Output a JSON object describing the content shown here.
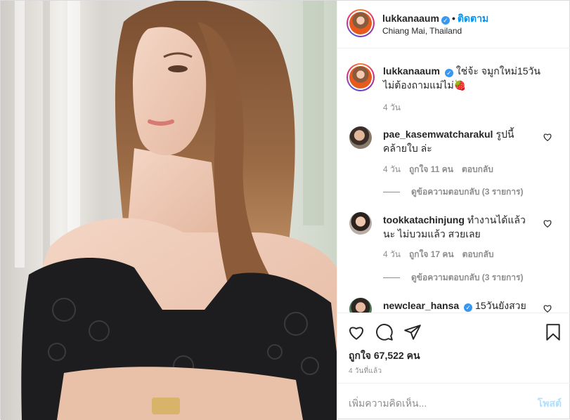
{
  "header": {
    "username": "lukkanaaum",
    "separator": "•",
    "follow_label": "ติดตาม",
    "location": "Chiang Mai, Thailand"
  },
  "caption": {
    "username": "lukkanaaum",
    "text": "ใช่จ้ะ จมูกใหม่15วัน ไม่ต้องถามแม่ไม่🍓",
    "time": "4 วัน"
  },
  "comments": [
    {
      "username": "pae_kasemwatcharakul",
      "text": "รูปนี้คล้ายใบ ล่ะ",
      "time": "4 วัน",
      "likes": "ถูกใจ 11 คน",
      "reply_label": "ตอบกลับ",
      "view_replies": "ดูข้อความตอบกลับ (3 รายการ)"
    },
    {
      "username": "tookkatachinjung",
      "text": "ทำงานได้แล้วนะ ไม่บวมแล้ว สวยเลย",
      "time": "4 วัน",
      "likes": "ถูกใจ 17 คน",
      "reply_label": "ตอบกลับ",
      "view_replies": "ดูข้อความตอบกลับ (3 รายการ)"
    },
    {
      "username": "newclear_hansa",
      "text": "15วันยังสวย"
    }
  ],
  "actions": {
    "likes": "ถูกใจ 67,522 คน",
    "posted": "4 วันที่แล้ว"
  },
  "add_comment": {
    "placeholder": "เพิ่มความคิดเห็น...",
    "post_label": "โพสต์"
  },
  "icons": {
    "like": "heart-icon",
    "comment": "comment-icon",
    "share": "share-icon",
    "save": "bookmark-icon",
    "verified": "verified-badge-icon"
  },
  "colors": {
    "link_blue": "#0095f6",
    "verified_blue": "#3897f0",
    "muted": "#8e8e8e",
    "post_disabled": "#b2dffc"
  }
}
